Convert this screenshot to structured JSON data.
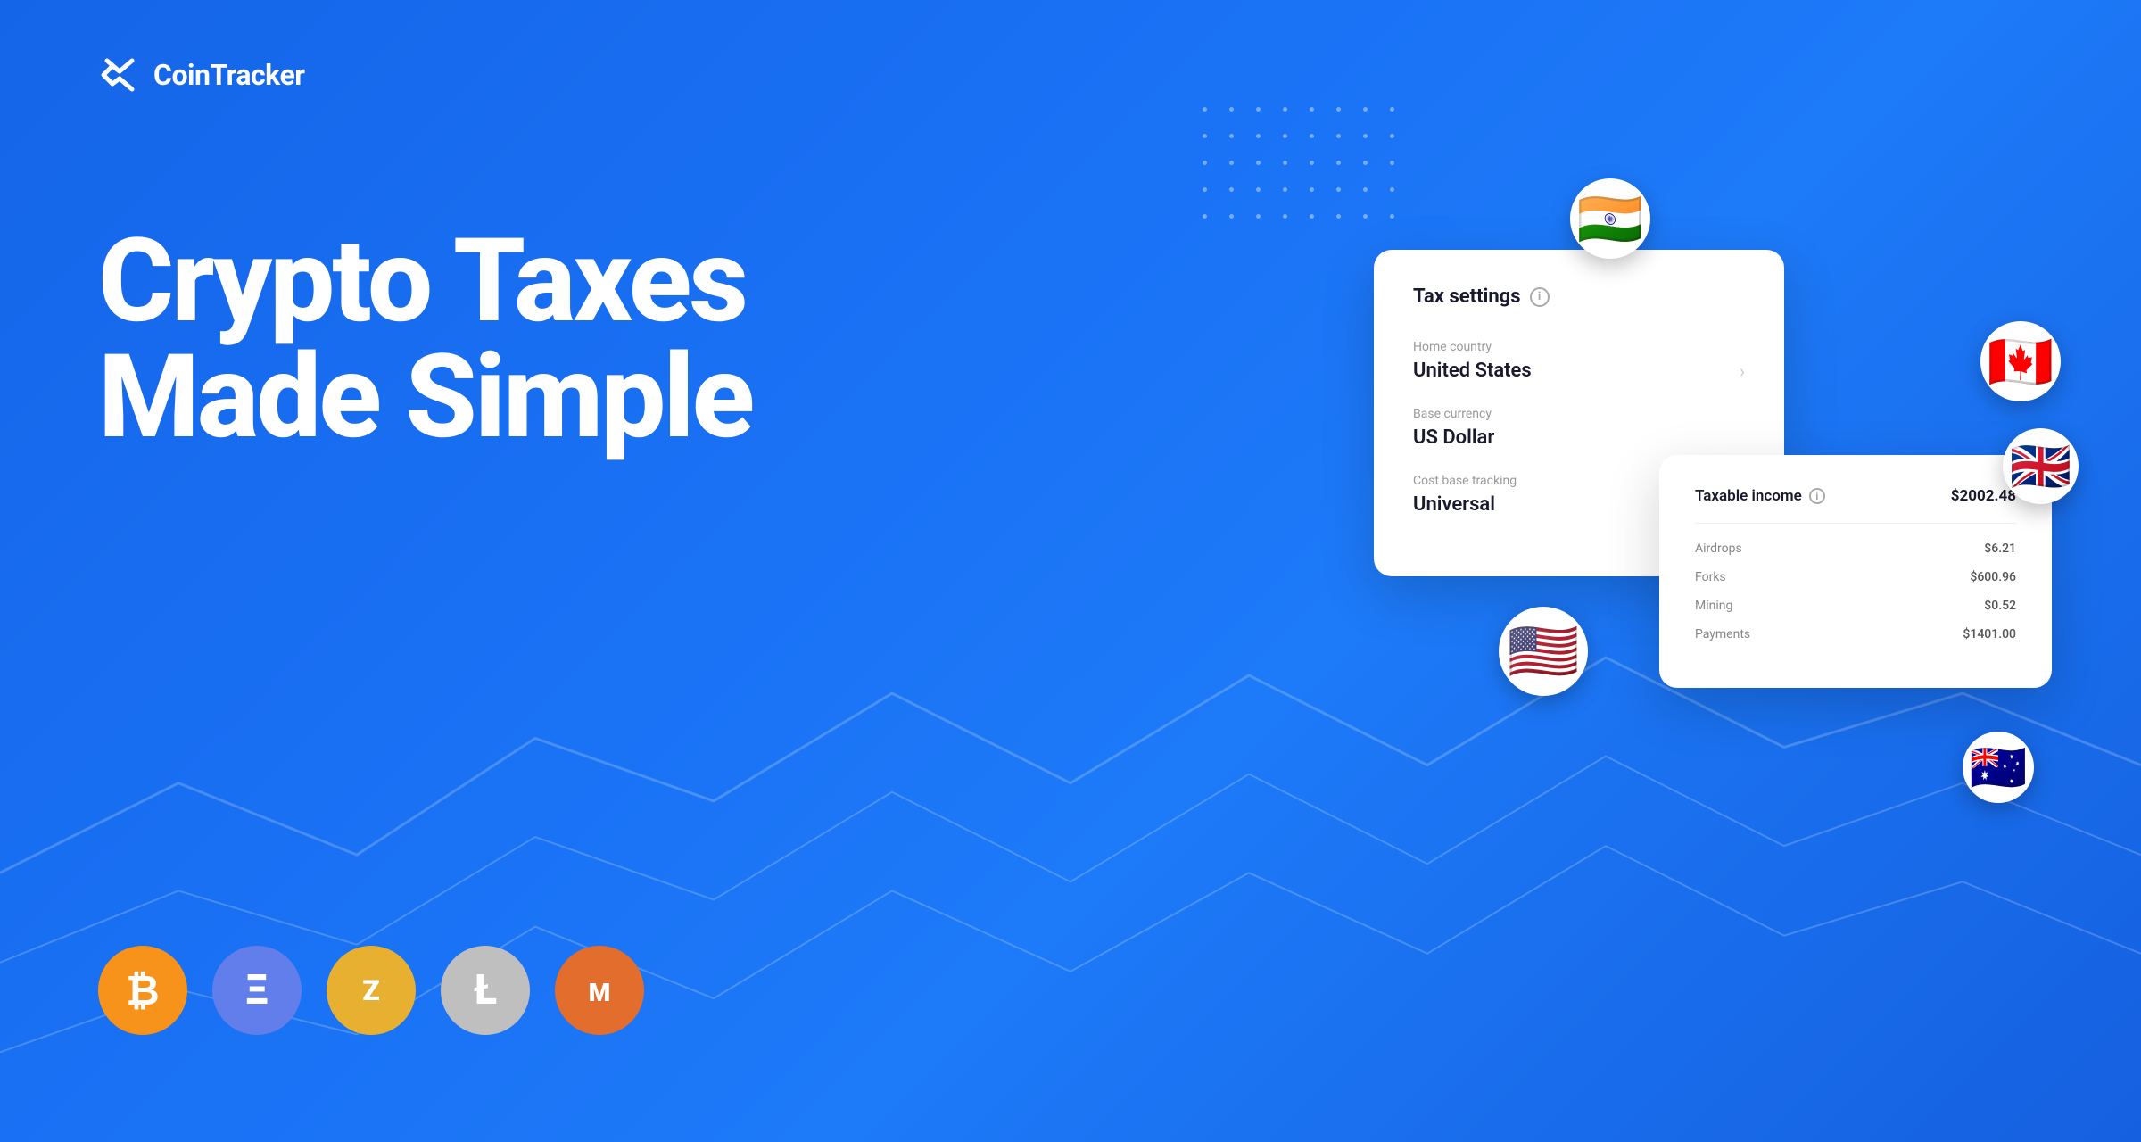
{
  "brand": {
    "name": "CoinTracker"
  },
  "hero": {
    "line1": "Crypto Taxes",
    "line2": "Made Simple"
  },
  "tax_card": {
    "title": "Tax settings",
    "home_country_label": "Home country",
    "home_country_value": "United States",
    "base_currency_label": "Base currency",
    "base_currency_value": "US Dollar",
    "cost_base_label": "Cost base tracking",
    "cost_base_value": "Universal"
  },
  "income_card": {
    "taxable_income_label": "Taxable income",
    "taxable_income_value": "$2002.48",
    "rows": [
      {
        "label": "Airdrops",
        "value": "$6.21"
      },
      {
        "label": "Forks",
        "value": "$600.96"
      },
      {
        "label": "Mining",
        "value": "$0.52"
      },
      {
        "label": "Payments",
        "value": "$1401.00"
      }
    ]
  },
  "crypto_coins": [
    {
      "id": "btc",
      "symbol": "₿",
      "label": "Bitcoin"
    },
    {
      "id": "eth",
      "symbol": "Ξ",
      "label": "Ethereum"
    },
    {
      "id": "zec",
      "symbol": "Ƶ",
      "label": "Zcash"
    },
    {
      "id": "ltc",
      "symbol": "Ł",
      "label": "Litecoin"
    },
    {
      "id": "xmr",
      "symbol": "ɱ",
      "label": "Monero"
    }
  ],
  "flags": {
    "india": "🇮🇳",
    "canada": "🇨🇦",
    "uk": "🇬🇧",
    "usa": "🇺🇸",
    "australia": "🇦🇺"
  },
  "colors": {
    "background": "#1a6ef5",
    "accent": "#1565e8",
    "card_bg": "#ffffff",
    "btc": "#f7931a",
    "eth": "#627eea",
    "zec": "#e8b030",
    "ltc": "#bfbfbf",
    "xmr": "#e36d2d"
  }
}
